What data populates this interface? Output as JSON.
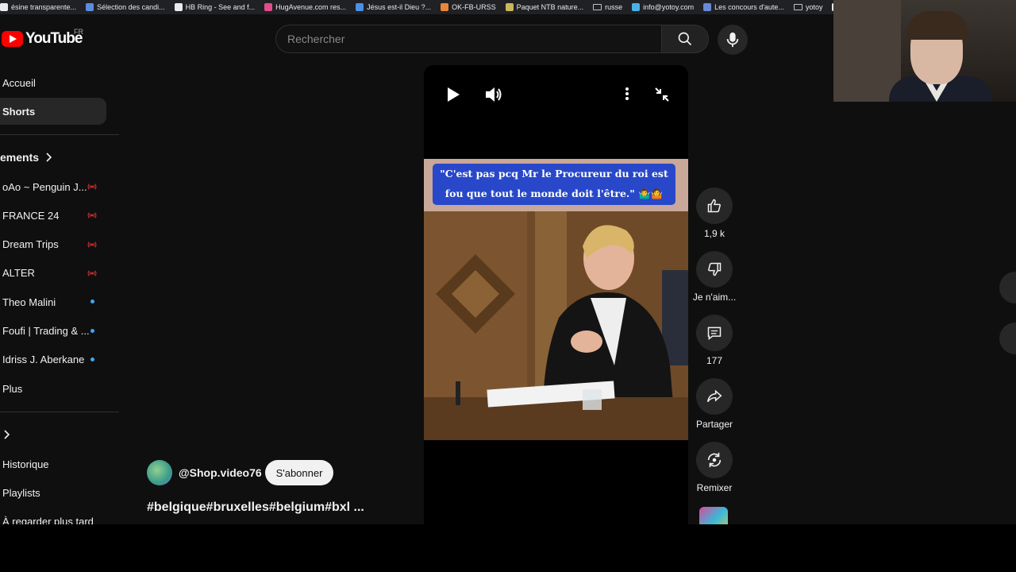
{
  "bookmarks": [
    {
      "label": "ésine transparente...",
      "color": "#e8eaed"
    },
    {
      "label": "Sélection des candi...",
      "color": "#5f8bdc"
    },
    {
      "label": "HB Ring - See and f...",
      "color": "#e8eaed"
    },
    {
      "label": "HugAvenue.com res...",
      "color": "#e34c8a"
    },
    {
      "label": "Jésus est-il Dieu ?...",
      "color": "#4a8fe8"
    },
    {
      "label": "OK-FB-URSS",
      "color": "#e8873a"
    },
    {
      "label": "Paquet NTB nature...",
      "color": "#c8b85a"
    },
    {
      "label": "russe",
      "color": "folder"
    },
    {
      "label": "info@yotoy.com",
      "color": "#4ab0e8"
    },
    {
      "label": "Les concours d'aute...",
      "color": "#6a8ad8"
    },
    {
      "label": "yotoy",
      "color": "folder"
    },
    {
      "label": "i",
      "color": "#e8eaed"
    }
  ],
  "header": {
    "logo_text": "YouTube",
    "country_code": "FR",
    "search_placeholder": "Rechercher"
  },
  "sidebar": {
    "items_top": [
      {
        "label": "Accueil",
        "active": false
      },
      {
        "label": "Shorts",
        "active": true
      }
    ],
    "subscriptions_heading": "ements",
    "subscriptions": [
      {
        "label": "oAo ~ Penguin J...",
        "status": "live"
      },
      {
        "label": "FRANCE 24",
        "status": "live"
      },
      {
        "label": "Dream Trips",
        "status": "live"
      },
      {
        "label": "ALTER",
        "status": "live"
      },
      {
        "label": "Theo Malini",
        "status": "new"
      },
      {
        "label": "Foufi | Trading & ...",
        "status": "new"
      },
      {
        "label": "Idriss J. Aberkane",
        "status": "new"
      },
      {
        "label": "Plus",
        "status": ""
      }
    ],
    "you_section": [
      {
        "label": "Historique"
      },
      {
        "label": "Playlists"
      },
      {
        "label": "À regarder plus tard"
      }
    ]
  },
  "video": {
    "caption": "\"C'est pas pcq Mr le Procureur du roi est fou que tout le monde doit l'être.\" 🤷‍♂️🤷"
  },
  "actions": {
    "like_count": "1,9 k",
    "dislike_label": "Je n'aim...",
    "comments_count": "177",
    "share_label": "Partager",
    "remix_label": "Remixer"
  },
  "channel": {
    "handle": "@Shop.video76",
    "subscribe_label": "S'abonner",
    "title": "#belgique#bruxelles#belgium#bxl ..."
  },
  "colors": {
    "brand_red": "#ff0000",
    "live_red": "#e53935",
    "new_dot_blue": "#3ea6ff",
    "caption_blue": "#2848c9"
  }
}
